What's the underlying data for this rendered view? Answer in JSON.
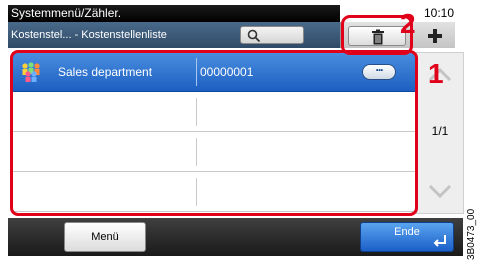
{
  "header": {
    "title": "Systemmenü/Zähler.",
    "clock": "10:10",
    "breadcrumb": "Kostenstel... - Kostenstellenliste"
  },
  "toolbar": {
    "search_icon": "search-icon",
    "delete_icon": "trash-icon",
    "add_icon": "plus-icon"
  },
  "list": {
    "rows": [
      {
        "name": "Sales department",
        "number": "00000001",
        "selected": true,
        "icon": "group-icon",
        "detail_label": "..."
      },
      {
        "name": "",
        "number": "",
        "selected": false
      },
      {
        "name": "",
        "number": "",
        "selected": false
      },
      {
        "name": "",
        "number": "",
        "selected": false
      }
    ]
  },
  "pager": {
    "page_count": "1/1"
  },
  "footer": {
    "menu_label": "Menü",
    "end_label": "Ende"
  },
  "annotations": {
    "callout_1": "1",
    "callout_2": "2",
    "doc_ref": "3B0473_00"
  },
  "colors": {
    "selected_row": "#1c5fc2",
    "callout": "#e0001a",
    "title_bar": "#000000"
  }
}
